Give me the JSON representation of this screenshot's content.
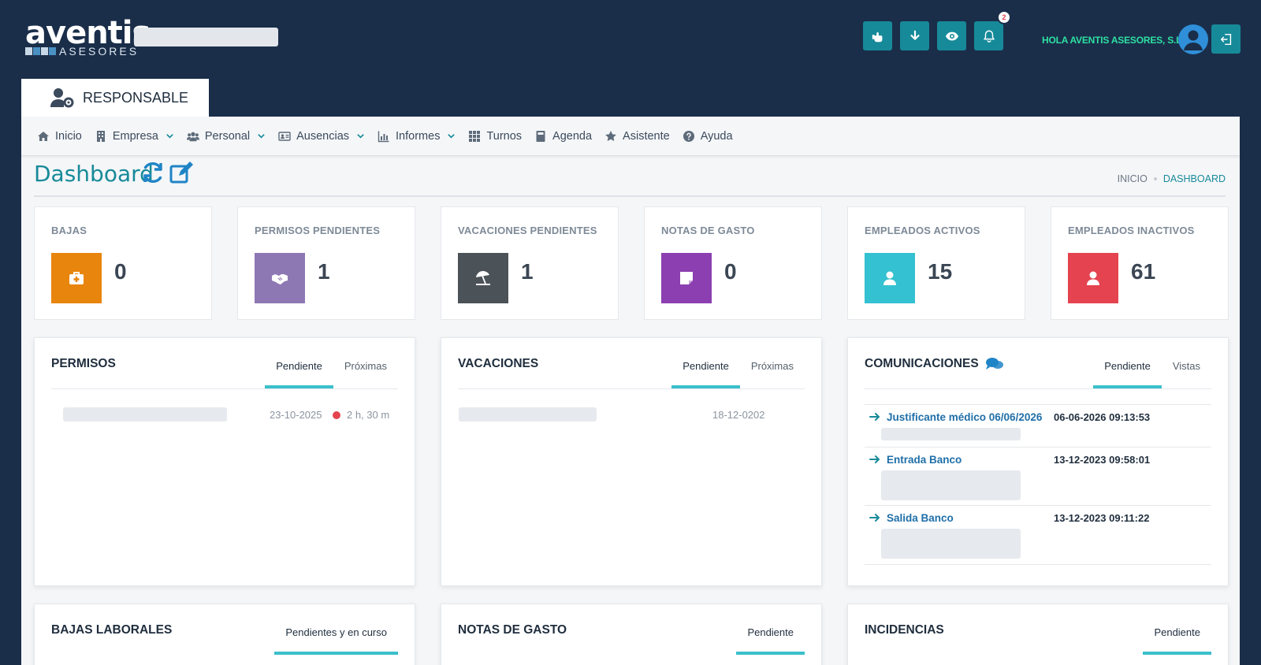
{
  "header": {
    "logo_word": "aventis",
    "logo_sub": "ASESORES",
    "greeting": "HOLA AVENTIS ASESORES, S.L.",
    "notifications_count": "2",
    "actions": [
      "hand-point-icon",
      "download-icon",
      "eye-icon",
      "bell-icon"
    ],
    "accent": "#178a99"
  },
  "role_tab": {
    "label": "RESPONSABLE"
  },
  "nav": {
    "items": [
      {
        "label": "Inicio",
        "icon": "home-icon",
        "dropdown": false
      },
      {
        "label": "Empresa",
        "icon": "building-icon",
        "dropdown": true
      },
      {
        "label": "Personal",
        "icon": "users-icon",
        "dropdown": true
      },
      {
        "label": "Ausencias",
        "icon": "id-card-icon",
        "dropdown": true
      },
      {
        "label": "Informes",
        "icon": "chart-icon",
        "dropdown": true
      },
      {
        "label": "Turnos",
        "icon": "grid-icon",
        "dropdown": false
      },
      {
        "label": "Agenda",
        "icon": "book-icon",
        "dropdown": false
      },
      {
        "label": "Asistente",
        "icon": "star-icon",
        "dropdown": false
      },
      {
        "label": "Ayuda",
        "icon": "question-icon",
        "dropdown": false
      }
    ]
  },
  "page": {
    "title": "Dashboard",
    "breadcrumb_home": "INICIO",
    "breadcrumb_current": "DASHBOARD"
  },
  "stats": [
    {
      "label": "BAJAS",
      "value": "0",
      "color": "#e8850c",
      "icon": "medkit-icon"
    },
    {
      "label": "PERMISOS PENDIENTES",
      "value": "1",
      "color": "#8e78b4",
      "icon": "handshake-icon"
    },
    {
      "label": "VACACIONES PENDIENTES",
      "value": "1",
      "color": "#4b5258",
      "icon": "umbrella-beach-icon"
    },
    {
      "label": "NOTAS DE GASTO",
      "value": "0",
      "color": "#8c3fb0",
      "icon": "sticky-note-icon"
    },
    {
      "label": "EMPLEADOS ACTIVOS",
      "value": "15",
      "color": "#34c1d1",
      "icon": "user-icon"
    },
    {
      "label": "EMPLEADOS INACTIVOS",
      "value": "61",
      "color": "#e4434f",
      "icon": "user-icon"
    }
  ],
  "permisos": {
    "title": "PERMISOS",
    "tabs": [
      "Pendiente",
      "Próximas"
    ],
    "row": {
      "date": "23-10-2025",
      "duration": "2 h, 30 m"
    }
  },
  "vacaciones": {
    "title": "VACACIONES",
    "tabs": [
      "Pendiente",
      "Próximas"
    ],
    "row": {
      "date": "18-12-0202"
    }
  },
  "comunicaciones": {
    "title": "COMUNICACIONES",
    "tabs": [
      "Pendiente",
      "Vistas"
    ],
    "items": [
      {
        "title": "Justificante médico 06/06/2026",
        "date": "06-06-2026 09:13:53"
      },
      {
        "title": "Entrada Banco",
        "date": "13-12-2023 09:58:01"
      },
      {
        "title": "Salida Banco",
        "date": "13-12-2023 09:11:22"
      }
    ]
  },
  "bottom_widgets": [
    {
      "title": "BAJAS LABORALES",
      "tab": "Pendientes y en curso"
    },
    {
      "title": "NOTAS DE GASTO",
      "tab": "Pendiente"
    },
    {
      "title": "INCIDENCIAS",
      "tab": "Pendiente"
    }
  ]
}
